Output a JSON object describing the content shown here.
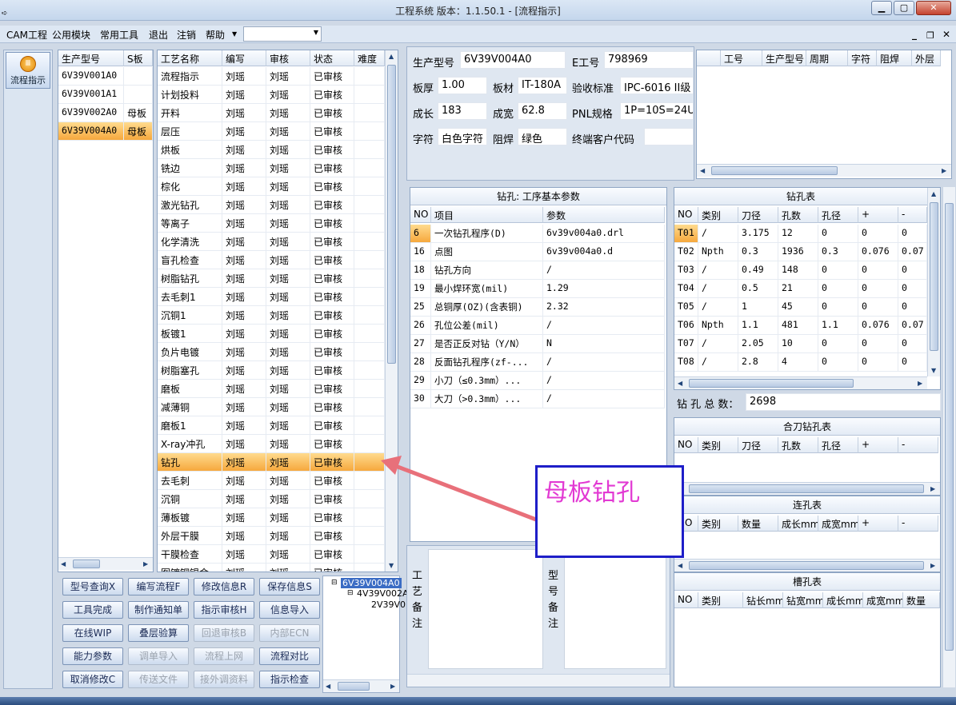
{
  "window": {
    "title": "工程系统  版本：1.1.50.1 - [流程指示]",
    "min": "▁",
    "max": "▢",
    "close": "✕"
  },
  "menu": [
    "CAM工程",
    "公用模块",
    "常用工具",
    "退出",
    "注销",
    "帮助"
  ],
  "mdi": {
    "min": "_",
    "restore": "❐",
    "close": "✕"
  },
  "dock": {
    "flow_label": "流程指示"
  },
  "models": {
    "headers": [
      "生产型号",
      "S板"
    ],
    "rows": [
      {
        "model": "6V39V001A0",
        "s": ""
      },
      {
        "model": "6V39V001A1",
        "s": ""
      },
      {
        "model": "6V39V002A0",
        "s": "母板"
      },
      {
        "model": "6V39V004A0",
        "s": "母板",
        "selected": true
      }
    ]
  },
  "process": {
    "headers": [
      "工艺名称",
      "编写",
      "审核",
      "状态",
      "难度"
    ],
    "rows": [
      [
        "流程指示",
        "刘瑶",
        "刘瑶",
        "已审核"
      ],
      [
        "计划投料",
        "刘瑶",
        "刘瑶",
        "已审核"
      ],
      [
        "开料",
        "刘瑶",
        "刘瑶",
        "已审核"
      ],
      [
        "层压",
        "刘瑶",
        "刘瑶",
        "已审核"
      ],
      [
        "烘板",
        "刘瑶",
        "刘瑶",
        "已审核"
      ],
      [
        "铣边",
        "刘瑶",
        "刘瑶",
        "已审核"
      ],
      [
        "棕化",
        "刘瑶",
        "刘瑶",
        "已审核"
      ],
      [
        "激光钻孔",
        "刘瑶",
        "刘瑶",
        "已审核"
      ],
      [
        "等离子",
        "刘瑶",
        "刘瑶",
        "已审核"
      ],
      [
        "化学清洗",
        "刘瑶",
        "刘瑶",
        "已审核"
      ],
      [
        "盲孔检查",
        "刘瑶",
        "刘瑶",
        "已审核"
      ],
      [
        "树脂钻孔",
        "刘瑶",
        "刘瑶",
        "已审核"
      ],
      [
        "去毛刺1",
        "刘瑶",
        "刘瑶",
        "已审核"
      ],
      [
        "沉铜1",
        "刘瑶",
        "刘瑶",
        "已审核"
      ],
      [
        "板镀1",
        "刘瑶",
        "刘瑶",
        "已审核"
      ],
      [
        "负片电镀",
        "刘瑶",
        "刘瑶",
        "已审核"
      ],
      [
        "树脂塞孔",
        "刘瑶",
        "刘瑶",
        "已审核"
      ],
      [
        "磨板",
        "刘瑶",
        "刘瑶",
        "已审核"
      ],
      [
        "减薄铜",
        "刘瑶",
        "刘瑶",
        "已审核"
      ],
      [
        "磨板1",
        "刘瑶",
        "刘瑶",
        "已审核"
      ],
      [
        "X-ray冲孔",
        "刘瑶",
        "刘瑶",
        "已审核"
      ],
      [
        "钻孔",
        "刘瑶",
        "刘瑶",
        "已审核"
      ],
      [
        "去毛刺",
        "刘瑶",
        "刘瑶",
        "已审核"
      ],
      [
        "沉铜",
        "刘瑶",
        "刘瑶",
        "已审核"
      ],
      [
        "薄板镀",
        "刘瑶",
        "刘瑶",
        "已审核"
      ],
      [
        "外层干膜",
        "刘瑶",
        "刘瑶",
        "已审核"
      ],
      [
        "干膜检查",
        "刘瑶",
        "刘瑶",
        "已审核"
      ],
      [
        "图镀铜锡金",
        "刘瑶",
        "刘瑶",
        "已审核"
      ]
    ],
    "selected_index": 21
  },
  "buttons": [
    [
      "型号查询X",
      "编写流程F",
      "修改信息R",
      "保存信息S"
    ],
    [
      "工具完成",
      "制作通知单",
      "指示审核H",
      "信息导入"
    ],
    [
      "在线WIP",
      "叠层验算",
      "回退审核B",
      "内部ECN"
    ],
    [
      "能力参数",
      "调单导入",
      "流程上网",
      "流程对比"
    ],
    [
      "取消修改C",
      "传送文件",
      "接外调资料",
      "指示检查"
    ]
  ],
  "disabled_buttons": [
    "内部ECN",
    "调单导入",
    "流程上网",
    "传送文件",
    "接外调资料",
    "回退审核B"
  ],
  "tree": [
    "6V39V004A0",
    "4V39V002A",
    "2V39V0"
  ],
  "info": {
    "model_label": "生产型号",
    "model": "6V39V004A0",
    "e_label": "E工号",
    "e": "798969",
    "thick_label": "板厚",
    "thick": "1.00",
    "mat_label": "板材",
    "mat": "IT-180A",
    "std_label": "验收标准",
    "std": "IPC-6016 II级",
    "len_label": "成长",
    "len": "183",
    "wid_label": "成宽",
    "wid": "62.8",
    "pnl_label": "PNL规格",
    "pnl": "1P=10S=24U",
    "char_label": "字符",
    "char": "白色字符",
    "mask_label": "阻焊",
    "mask": "绿色",
    "cust_label": "终端客户代码",
    "cust": ""
  },
  "toprightgrid": {
    "headers": [
      "工号",
      "生产型号",
      "周期",
      "字符",
      "阻焊",
      "外层"
    ]
  },
  "params": {
    "title": "钻孔: 工序基本参数",
    "headers": [
      "NO",
      "项目",
      "参数"
    ],
    "rows": [
      [
        "6",
        "一次钻孔程序(D)",
        "6v39v004a0.drl"
      ],
      [
        "16",
        "点图",
        "6v39v004a0.d"
      ],
      [
        "18",
        "钻孔方向",
        "/"
      ],
      [
        "19",
        "最小焊环宽(mil)",
        "1.29"
      ],
      [
        "25",
        "总铜厚(OZ)(含表铜)",
        "2.32"
      ],
      [
        "26",
        "孔位公差(mil)",
        "/"
      ],
      [
        "27",
        "是否正反对钻（Y/N）",
        "N"
      ],
      [
        "28",
        "反面钻孔程序(zf-...",
        "/"
      ],
      [
        "29",
        "小刀（≤0.3mm）...",
        "/"
      ],
      [
        "30",
        "大刀（>0.3mm）...",
        "/"
      ]
    ]
  },
  "drill": {
    "title": "钻孔表",
    "headers": [
      "NO",
      "类别",
      "刀径",
      "孔数",
      "孔径",
      "+",
      "-"
    ],
    "rows": [
      [
        "T01",
        "/",
        "3.175",
        "12",
        "0",
        "0",
        "0"
      ],
      [
        "T02",
        "Npth",
        "0.3",
        "1936",
        "0.3",
        "0.076",
        "0.07"
      ],
      [
        "T03",
        "/",
        "0.49",
        "148",
        "0",
        "0",
        "0"
      ],
      [
        "T04",
        "/",
        "0.5",
        "21",
        "0",
        "0",
        "0"
      ],
      [
        "T05",
        "/",
        "1",
        "45",
        "0",
        "0",
        "0"
      ],
      [
        "T06",
        "Npth",
        "1.1",
        "481",
        "1.1",
        "0.076",
        "0.07"
      ],
      [
        "T07",
        "/",
        "2.05",
        "10",
        "0",
        "0",
        "0"
      ],
      [
        "T08",
        "/",
        "2.8",
        "4",
        "0",
        "0",
        "0"
      ]
    ],
    "total_label": "钻 孔 总 数：",
    "total": "2698"
  },
  "combo_table": {
    "title": "合刀钻孔表",
    "headers": [
      "NO",
      "类别",
      "刀径",
      "孔数",
      "孔径",
      "+",
      "-"
    ]
  },
  "link_table": {
    "title": "连孔表",
    "headers": [
      "NO",
      "类别",
      "数量",
      "成长mm",
      "成宽mm",
      "+",
      "-"
    ]
  },
  "slot_table": {
    "title": "槽孔表",
    "headers": [
      "NO",
      "类别",
      "钻长mm",
      "钻宽mm",
      "成长mm",
      "成宽mm",
      "数量"
    ]
  },
  "memo": {
    "process_label": "工艺备注",
    "model_label": "型号备注"
  },
  "annotation": {
    "text": "母板钻孔"
  },
  "colors": {
    "selection": "#f6a83d",
    "annotation_border": "#1e1ec8",
    "annotation_text": "#e23ad3",
    "arrow": "#e8707a"
  }
}
